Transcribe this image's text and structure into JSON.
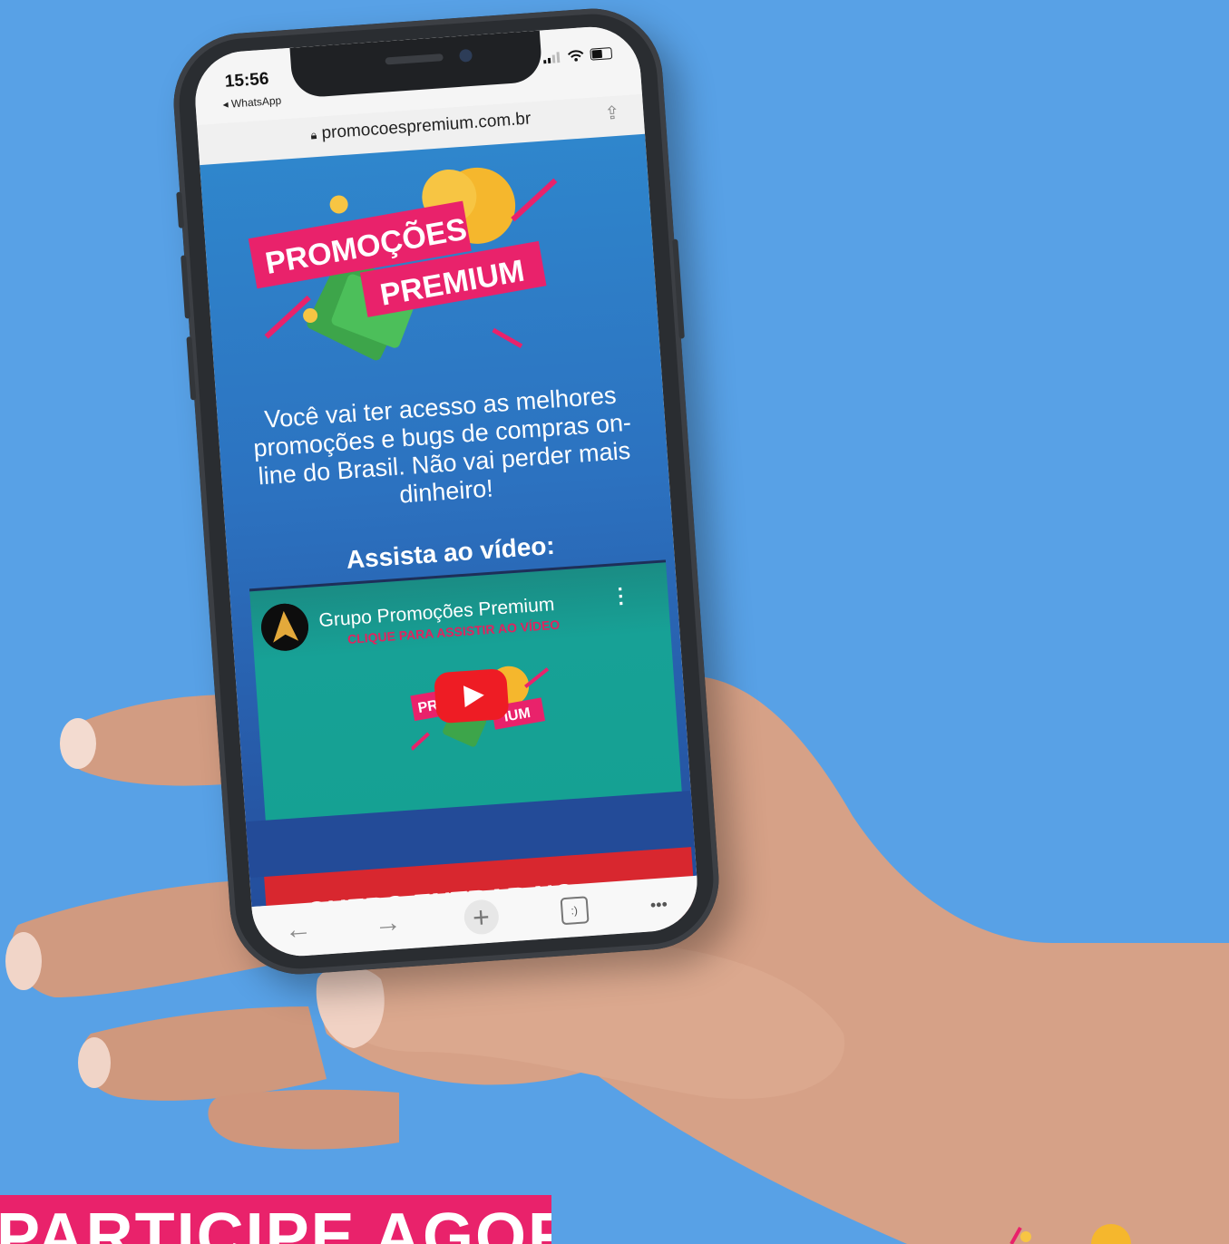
{
  "phone": {
    "status": {
      "time": "15:56",
      "back_app": "◂ WhatsApp"
    },
    "browser": {
      "url": "promocoespremium.com.br"
    },
    "page": {
      "logo_line1": "PROMOÇÕES",
      "logo_line2": "PREMIUM",
      "description": "Você vai ter acesso as melhores promoções e bugs de compras on-line do Brasil. Não vai perder mais dinheiro!",
      "video_heading": "Assista ao vídeo:",
      "video": {
        "channel": "Grupo Promoções Premium",
        "subtitle": "CLIQUE PARA ASSISTIR AO VÍDEO",
        "thumb_left": "PR",
        "thumb_right": "IUM"
      },
      "cta_label": "QUERO ENTRAR NO",
      "cta_arrow": "»"
    },
    "toolbar": {
      "tabs_label": ":)",
      "more_label": "•••"
    }
  },
  "banner": {
    "text": "PARTICIPE AGORA"
  },
  "colors": {
    "background": "#58a1e6",
    "pink": "#e9226b",
    "cta_red": "#d8272f",
    "video_teal": "#15a193"
  }
}
